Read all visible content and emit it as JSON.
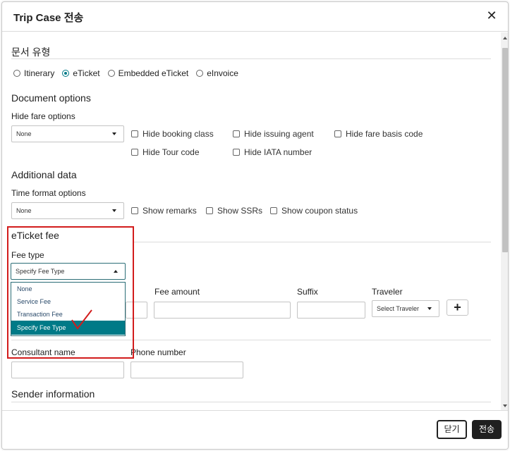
{
  "dialog": {
    "title": "Trip Case 전송",
    "close_glyph": "✕"
  },
  "doc_type": {
    "title": "문서 유형",
    "options": [
      "Itinerary",
      "eTicket",
      "Embedded eTicket",
      "eInvoice"
    ],
    "selected": "eTicket"
  },
  "document_options": {
    "title": "Document options",
    "hide_fare_label": "Hide fare options",
    "hide_fare_value": "None",
    "checkboxes": [
      "Hide booking class",
      "Hide issuing agent",
      "Hide fare basis code",
      "Hide Tour code",
      "Hide IATA number"
    ]
  },
  "additional": {
    "title": "Additional data",
    "time_format_label": "Time format options",
    "time_format_value": "None",
    "checkboxes": [
      "Show remarks",
      "Show SSRs",
      "Show coupon status"
    ]
  },
  "eticket_fee": {
    "title": "eTicket fee",
    "fee_type_label": "Fee type",
    "fee_type_value": "Specify Fee Type",
    "dropdown_options": [
      "None",
      "Service Fee",
      "Transaction Fee",
      "Specify Fee Type"
    ],
    "dropdown_selected": "Specify Fee Type",
    "fee_amount_label": "Fee amount",
    "suffix_label": "Suffix",
    "traveler_label": "Traveler",
    "traveler_value": "Select Traveler",
    "add_glyph": "+"
  },
  "consultant": {
    "name_label": "Consultant name",
    "phone_label": "Phone number"
  },
  "sender": {
    "title": "Sender information"
  },
  "footer": {
    "close_label": "닫기",
    "send_label": "전송"
  },
  "colors": {
    "accent": "#007a87",
    "highlight": "#d21c1c"
  }
}
